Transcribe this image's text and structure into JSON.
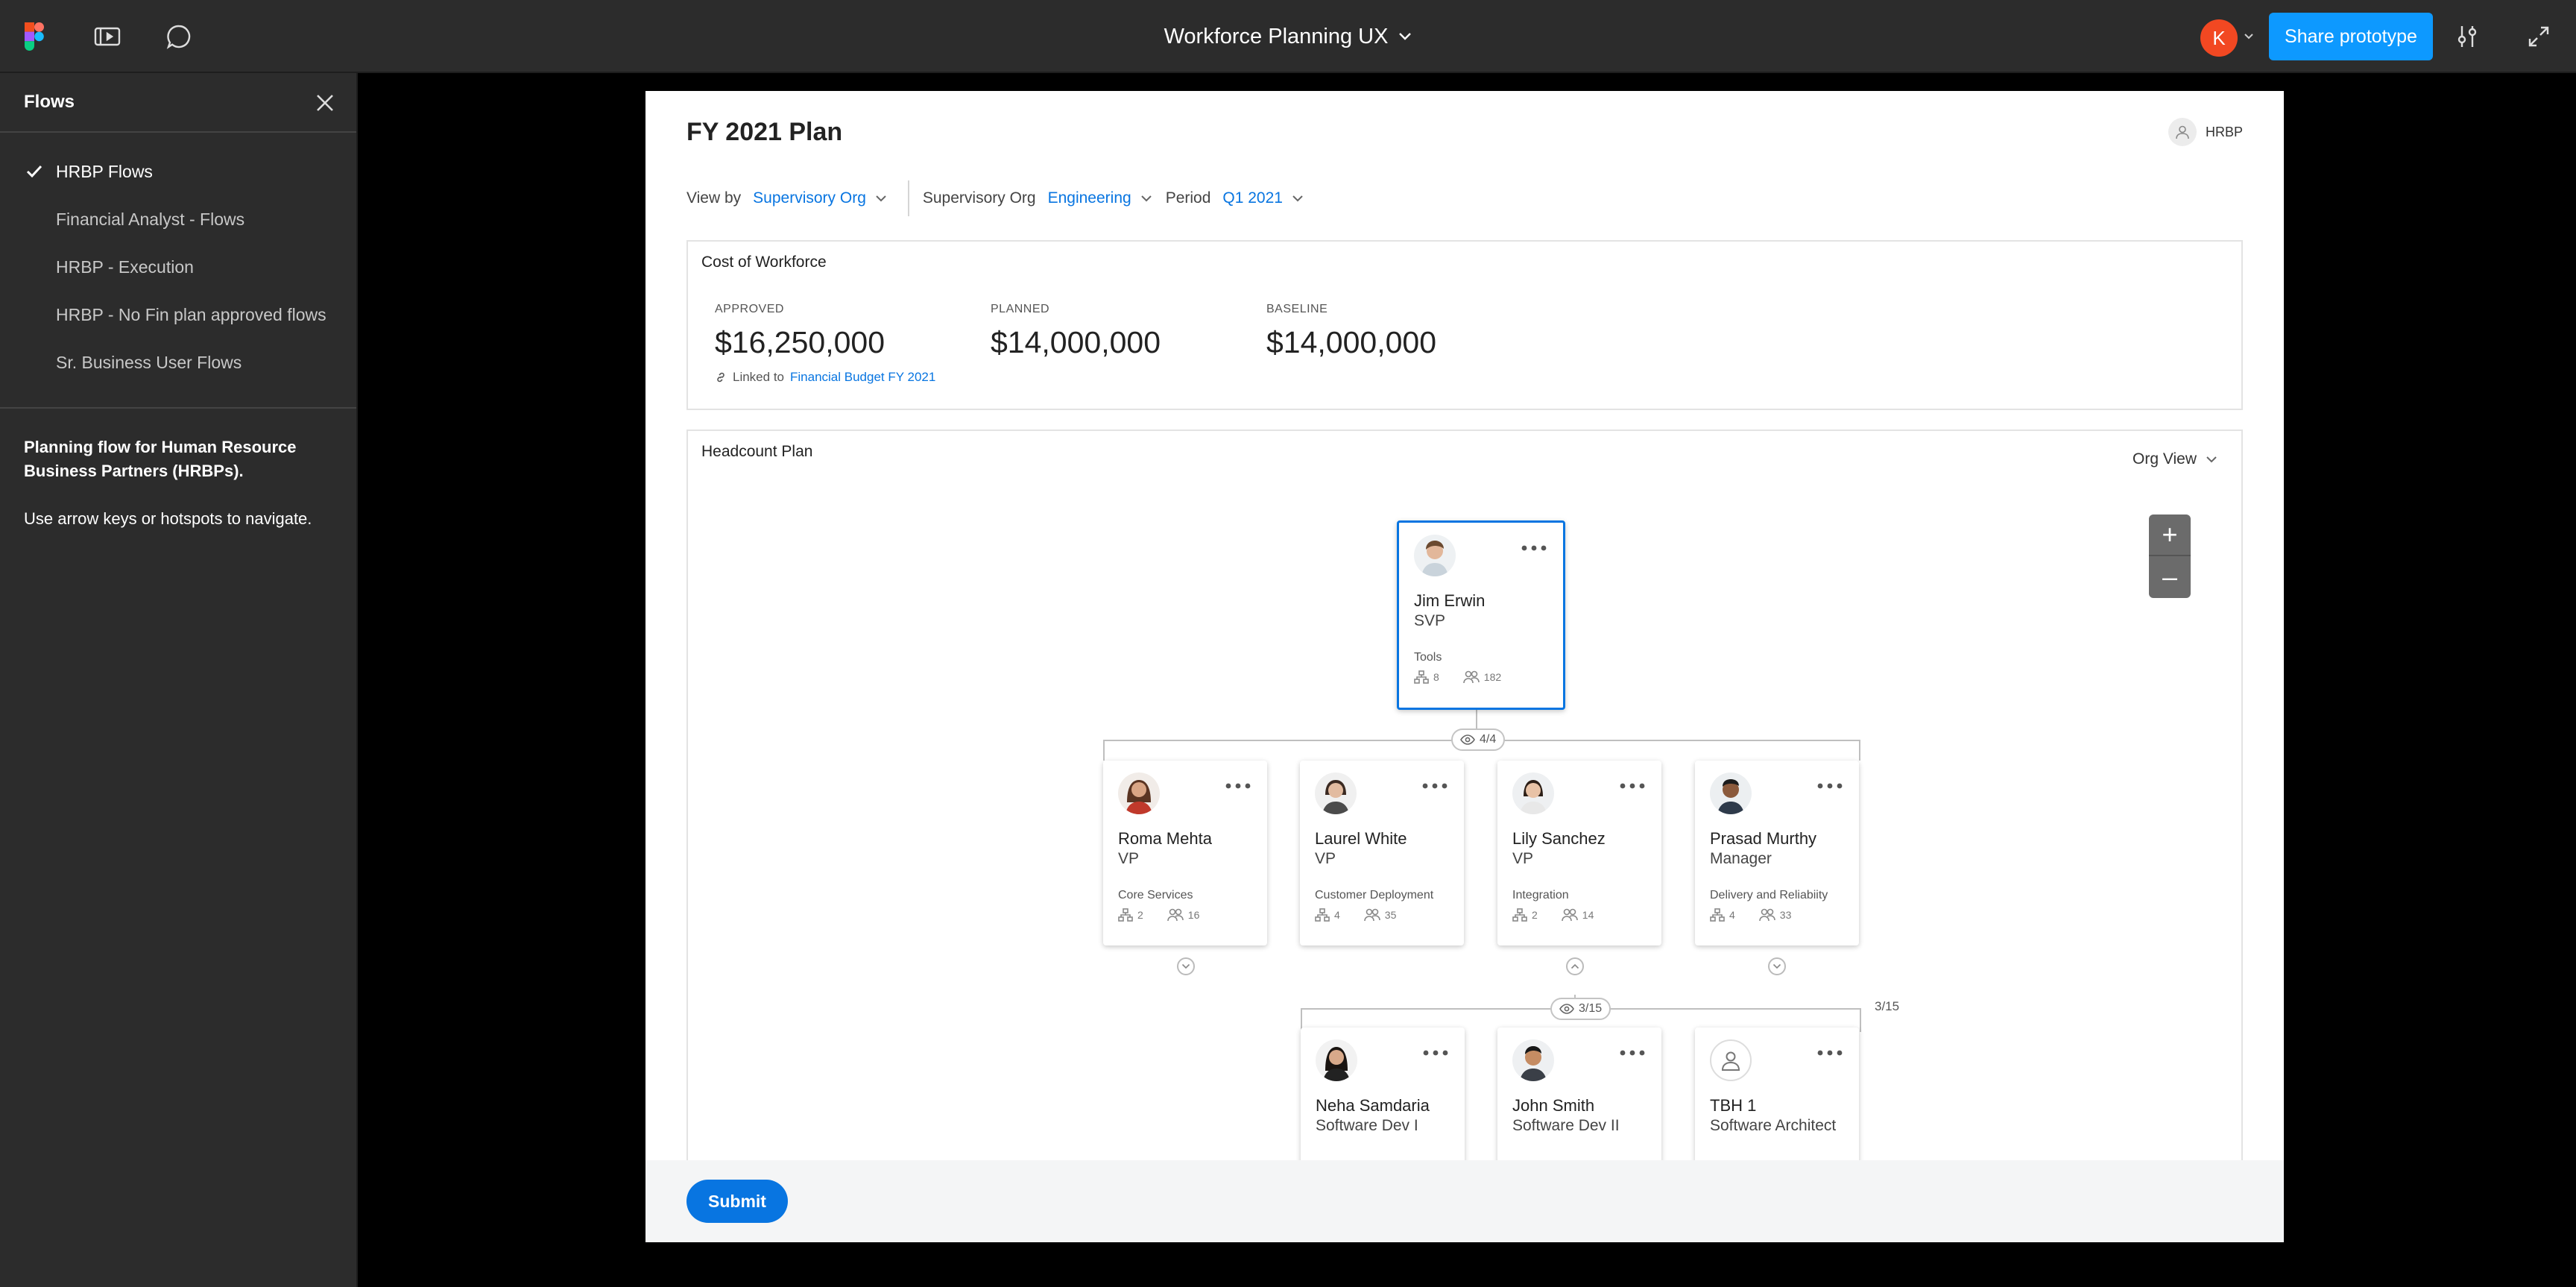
{
  "topbar": {
    "doc_title": "Workforce Planning UX",
    "avatar_initial": "K",
    "share_label": "Share prototype"
  },
  "sidebar": {
    "title": "Flows",
    "items": [
      {
        "label": "HRBP Flows",
        "active": true
      },
      {
        "label": "Financial Analyst - Flows"
      },
      {
        "label": "HRBP - Execution"
      },
      {
        "label": "HRBP - No Fin plan approved flows"
      },
      {
        "label": "Sr. Business User Flows"
      }
    ],
    "description": "Planning flow for Human Resource Business Partners (HRBPs).",
    "hint": "Use arrow keys or hotspots to navigate."
  },
  "page": {
    "title": "FY 2021 Plan",
    "role": "HRBP",
    "filters": {
      "view_by_label": "View by",
      "view_by_value": "Supervisory Org",
      "sup_org_label": "Supervisory Org",
      "sup_org_value": "Engineering",
      "period_label": "Period",
      "period_value": "Q1 2021"
    },
    "cost": {
      "title": "Cost of Workforce",
      "approved_label": "APPROVED",
      "approved_value": "$16,250,000",
      "planned_label": "PLANNED",
      "planned_value": "$14,000,000",
      "baseline_label": "BASELINE",
      "baseline_value": "$14,000,000",
      "linked_prefix": "Linked to",
      "linked_link": "Financial Budget FY 2021"
    },
    "headcount": {
      "title": "Headcount Plan",
      "view": "Org View",
      "zoom_in": "+",
      "zoom_out": "–",
      "root": {
        "name": "Jim Erwin",
        "title": "SVP",
        "dept": "Tools",
        "orgs": "8",
        "people": "182"
      },
      "level1_count": "4/4",
      "level1": [
        {
          "name": "Roma Mehta",
          "title": "VP",
          "dept": "Core Services",
          "orgs": "2",
          "people": "16"
        },
        {
          "name": "Laurel White",
          "title": "VP",
          "dept": "Customer Deployment",
          "orgs": "4",
          "people": "35"
        },
        {
          "name": "Lily Sanchez",
          "title": "VP",
          "dept": "Integration",
          "orgs": "2",
          "people": "14"
        },
        {
          "name": "Prasad Murthy",
          "title": "Manager",
          "dept": "Delivery and Reliabiity",
          "orgs": "4",
          "people": "33"
        }
      ],
      "level2_count": "3/15",
      "level2_side_count": "3/15",
      "level2": [
        {
          "name": "Neha Samdaria",
          "title": "Software Dev I"
        },
        {
          "name": "John Smith",
          "title": "Software Dev II"
        },
        {
          "name": "TBH 1",
          "title": "Software Architect"
        }
      ]
    },
    "submit_label": "Submit"
  }
}
